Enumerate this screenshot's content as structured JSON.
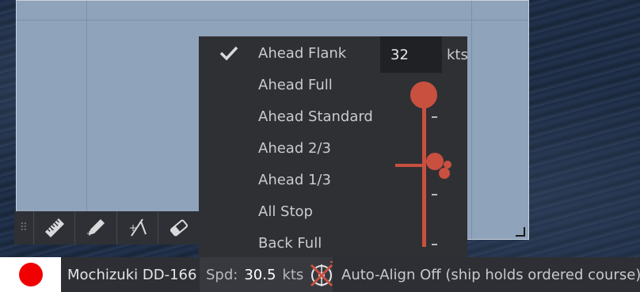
{
  "speed_menu": {
    "items": [
      {
        "label": "Ahead Flank",
        "checked": true
      },
      {
        "label": "Ahead Full",
        "checked": false
      },
      {
        "label": "Ahead Standard",
        "checked": false
      },
      {
        "label": "Ahead 2/3",
        "checked": false
      },
      {
        "label": "Ahead 1/3",
        "checked": false
      },
      {
        "label": "All Stop",
        "checked": false
      },
      {
        "label": "Back Full",
        "checked": false
      }
    ],
    "speed_input_value": "32",
    "speed_unit": "kts",
    "slider_level": 1.0,
    "tick_marks": [
      "-",
      "-",
      "-"
    ]
  },
  "toolbar": {
    "tools": [
      "ruler-icon",
      "pencil-icon",
      "compass-icon",
      "eraser-icon"
    ]
  },
  "status_bar": {
    "flag": "japan-flag",
    "ship_name": "Mochizuki DD-166",
    "speed_label": "Spd:",
    "speed_value": "30.5",
    "speed_unit": "kts",
    "auto_align_text": "Auto-Align Off (ship holds ordered course)"
  },
  "colors": {
    "accent": "#c9503f",
    "panel": "#2f3034",
    "chart_paper": "#8fa3ba",
    "flag_red": "#f00000"
  }
}
